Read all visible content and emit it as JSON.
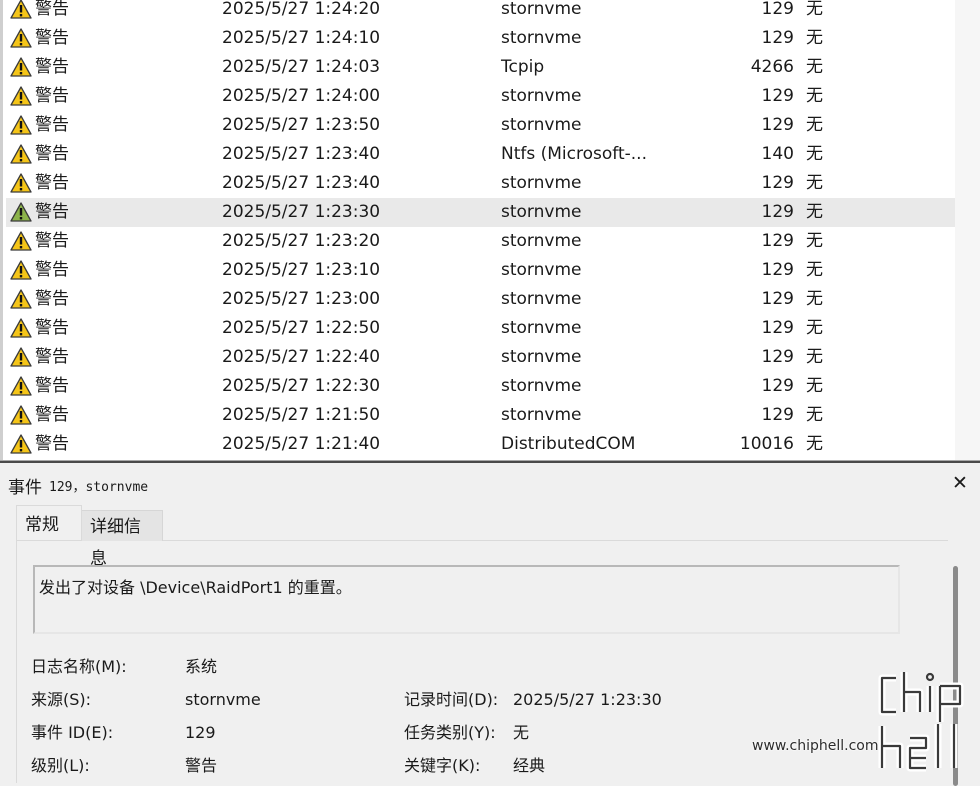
{
  "event_list": {
    "rows": [
      {
        "level": "警告",
        "datetime": "2025/5/27 1:24:20",
        "source": "stornvme",
        "event_id": "129",
        "task_category": "无"
      },
      {
        "level": "警告",
        "datetime": "2025/5/27 1:24:10",
        "source": "stornvme",
        "event_id": "129",
        "task_category": "无"
      },
      {
        "level": "警告",
        "datetime": "2025/5/27 1:24:03",
        "source": "Tcpip",
        "event_id": "4266",
        "task_category": "无"
      },
      {
        "level": "警告",
        "datetime": "2025/5/27 1:24:00",
        "source": "stornvme",
        "event_id": "129",
        "task_category": "无"
      },
      {
        "level": "警告",
        "datetime": "2025/5/27 1:23:50",
        "source": "stornvme",
        "event_id": "129",
        "task_category": "无"
      },
      {
        "level": "警告",
        "datetime": "2025/5/27 1:23:40",
        "source": "Ntfs (Microsoft-...",
        "event_id": "140",
        "task_category": "无"
      },
      {
        "level": "警告",
        "datetime": "2025/5/27 1:23:40",
        "source": "stornvme",
        "event_id": "129",
        "task_category": "无"
      },
      {
        "level": "警告",
        "datetime": "2025/5/27 1:23:30",
        "source": "stornvme",
        "event_id": "129",
        "task_category": "无"
      },
      {
        "level": "警告",
        "datetime": "2025/5/27 1:23:20",
        "source": "stornvme",
        "event_id": "129",
        "task_category": "无"
      },
      {
        "level": "警告",
        "datetime": "2025/5/27 1:23:10",
        "source": "stornvme",
        "event_id": "129",
        "task_category": "无"
      },
      {
        "level": "警告",
        "datetime": "2025/5/27 1:23:00",
        "source": "stornvme",
        "event_id": "129",
        "task_category": "无"
      },
      {
        "level": "警告",
        "datetime": "2025/5/27 1:22:50",
        "source": "stornvme",
        "event_id": "129",
        "task_category": "无"
      },
      {
        "level": "警告",
        "datetime": "2025/5/27 1:22:40",
        "source": "stornvme",
        "event_id": "129",
        "task_category": "无"
      },
      {
        "level": "警告",
        "datetime": "2025/5/27 1:22:30",
        "source": "stornvme",
        "event_id": "129",
        "task_category": "无"
      },
      {
        "level": "警告",
        "datetime": "2025/5/27 1:21:50",
        "source": "stornvme",
        "event_id": "129",
        "task_category": "无"
      },
      {
        "level": "警告",
        "datetime": "2025/5/27 1:21:40",
        "source": "DistributedCOM",
        "event_id": "10016",
        "task_category": "无"
      }
    ],
    "selected_index": 7
  },
  "detail_panel": {
    "title_label": "事件",
    "title_event": "129，stornvme",
    "close_glyph": "✕",
    "tabs": {
      "general": "常规",
      "details": "详细信息"
    },
    "description": "发出了对设备 \\Device\\RaidPort1 的重置。",
    "props": {
      "log_name_label": "日志名称(M):",
      "log_name_value": "系统",
      "source_label": "来源(S):",
      "source_value": "stornvme",
      "logged_label": "记录时间(D):",
      "logged_value": "2025/5/27 1:23:30",
      "event_id_label": "事件 ID(E):",
      "event_id_value": "129",
      "task_label": "任务类别(Y):",
      "task_value": "无",
      "level_label": "级别(L):",
      "level_value": "警告",
      "keywords_label": "关键字(K):",
      "keywords_value": "经典"
    }
  },
  "watermark": {
    "url": "www.chiphell.com",
    "logo_text": "chip hell"
  },
  "colors": {
    "warning_fill": "#f5c518",
    "warning_selected_fill": "#8cb34a",
    "selected_row": "#e9e9e9"
  },
  "icons": {
    "row_level": "warning-triangle-icon",
    "close": "close-icon"
  }
}
